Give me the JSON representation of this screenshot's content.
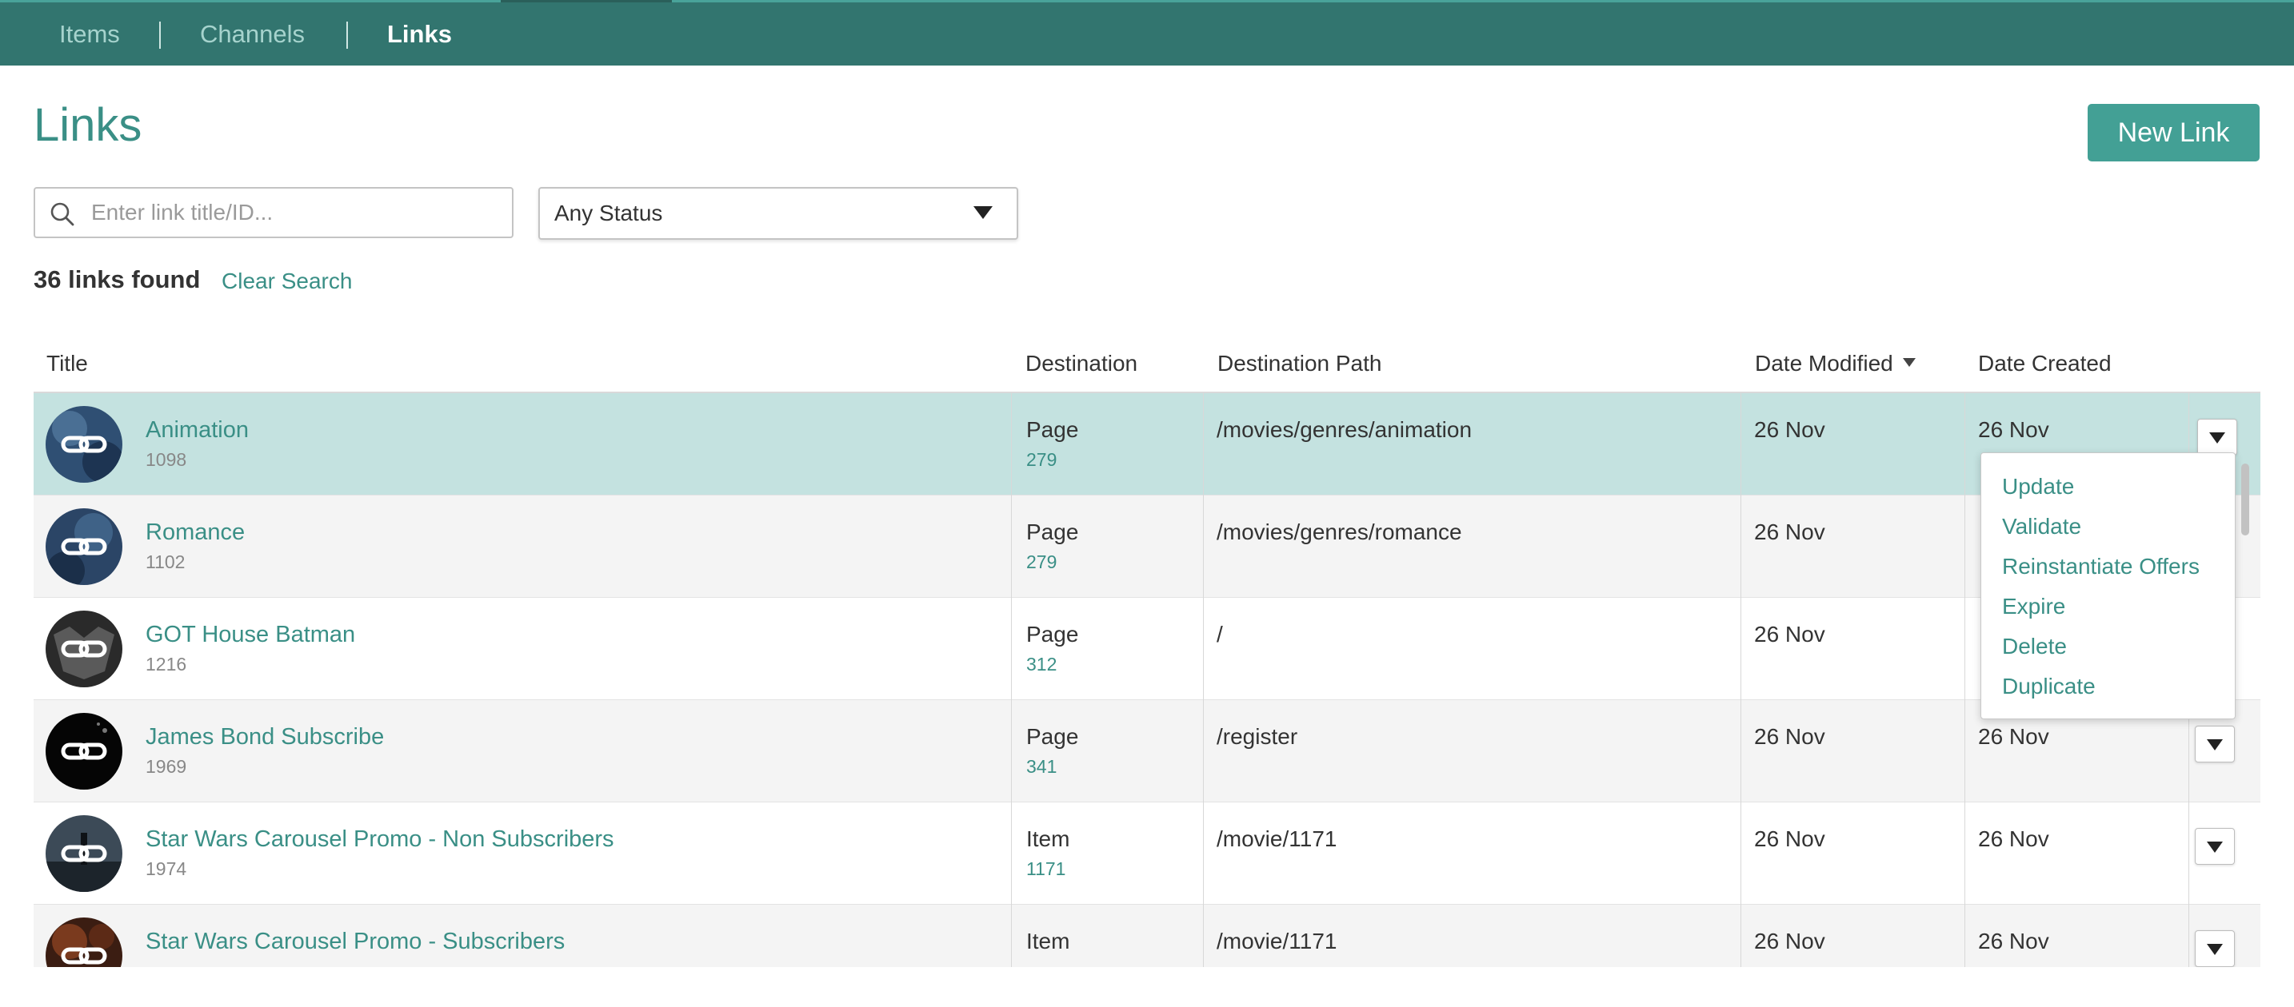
{
  "nav": {
    "items": [
      "Items",
      "Channels",
      "Links"
    ],
    "active": "Links"
  },
  "header": {
    "title": "Links",
    "new_button": "New Link"
  },
  "search": {
    "placeholder": "Enter link title/ID...",
    "value": ""
  },
  "status_filter": {
    "selected": "Any Status"
  },
  "results": {
    "count_label": "36 links found",
    "clear_label": "Clear Search"
  },
  "table": {
    "columns": [
      "Title",
      "Destination",
      "Destination Path",
      "Date Modified",
      "Date Created"
    ],
    "sorted_by": "Date Modified",
    "rows": [
      {
        "title": "Animation",
        "id": "1098",
        "dest": "Page",
        "dest_id": "279",
        "path": "/movies/genres/animation",
        "modified": "26 Nov",
        "created": "26 Nov"
      },
      {
        "title": "Romance",
        "id": "1102",
        "dest": "Page",
        "dest_id": "279",
        "path": "/movies/genres/romance",
        "modified": "26 Nov",
        "created": ""
      },
      {
        "title": "GOT House Batman",
        "id": "1216",
        "dest": "Page",
        "dest_id": "312",
        "path": "/",
        "modified": "26 Nov",
        "created": ""
      },
      {
        "title": "James Bond Subscribe",
        "id": "1969",
        "dest": "Page",
        "dest_id": "341",
        "path": "/register",
        "modified": "26 Nov",
        "created": "26 Nov"
      },
      {
        "title": "Star Wars Carousel Promo - Non Subscribers",
        "id": "1974",
        "dest": "Item",
        "dest_id": "1171",
        "path": "/movie/1171",
        "modified": "26 Nov",
        "created": "26 Nov"
      },
      {
        "title": "Star Wars Carousel Promo - Subscribers",
        "id": "",
        "dest": "Item",
        "dest_id": "",
        "path": "/movie/1171",
        "modified": "26 Nov",
        "created": "26 Nov"
      }
    ]
  },
  "menu": {
    "items": [
      "Update",
      "Validate",
      "Reinstantiate Offers",
      "Expire",
      "Delete",
      "Duplicate"
    ]
  },
  "colors": {
    "nav_bg": "#32756f",
    "accent": "#3a8f86",
    "button": "#43a095",
    "selected_row": "#c4e2e0"
  },
  "icons": {
    "search": "search-icon",
    "row_thumb": "link-icon",
    "dropdown": "caret-down-icon"
  }
}
